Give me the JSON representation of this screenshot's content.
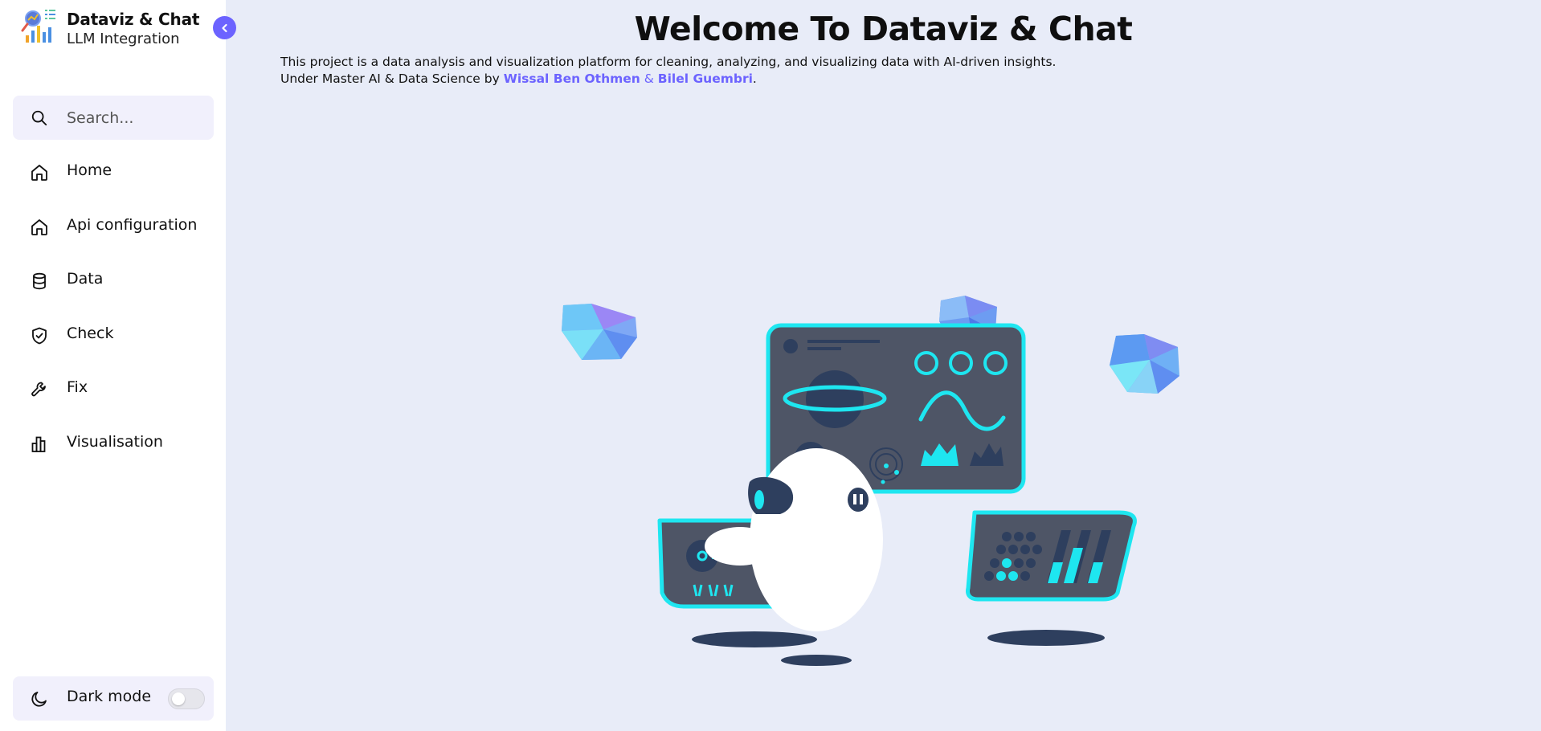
{
  "brand": {
    "title": "Dataviz & Chat",
    "subtitle": "LLM Integration",
    "collapse_icon": "chevron-left-icon"
  },
  "search": {
    "placeholder": "Search...",
    "icon": "search-icon"
  },
  "nav": {
    "items": [
      {
        "label": "Home",
        "icon": "home-icon"
      },
      {
        "label": "Api configuration",
        "icon": "home-icon"
      },
      {
        "label": "Data",
        "icon": "database-icon"
      },
      {
        "label": "Check",
        "icon": "shield-check-icon"
      },
      {
        "label": "Fix",
        "icon": "wrench-icon"
      },
      {
        "label": "Visualisation",
        "icon": "bar-chart-icon"
      }
    ]
  },
  "darkmode": {
    "label": "Dark mode",
    "icon": "moon-icon",
    "enabled": false
  },
  "main": {
    "title": "Welcome To Dataviz & Chat",
    "line1": "This project is a data analysis and visualization platform for cleaning, analyzing, and visualizing data with AI-driven insights.",
    "line2_prefix": "Under Master AI & Data Science by ",
    "author1": "Wissal Ben Othmen",
    "amp": " & ",
    "author2": "Bilel Guembri",
    "line2_suffix": "."
  },
  "colors": {
    "accent": "#6c63ff",
    "sidebar_bg": "#ffffff",
    "main_bg": "#e8ecf8",
    "cyan": "#1ee6f0",
    "panel": "#4e5566",
    "navy": "#2e3f5e"
  }
}
